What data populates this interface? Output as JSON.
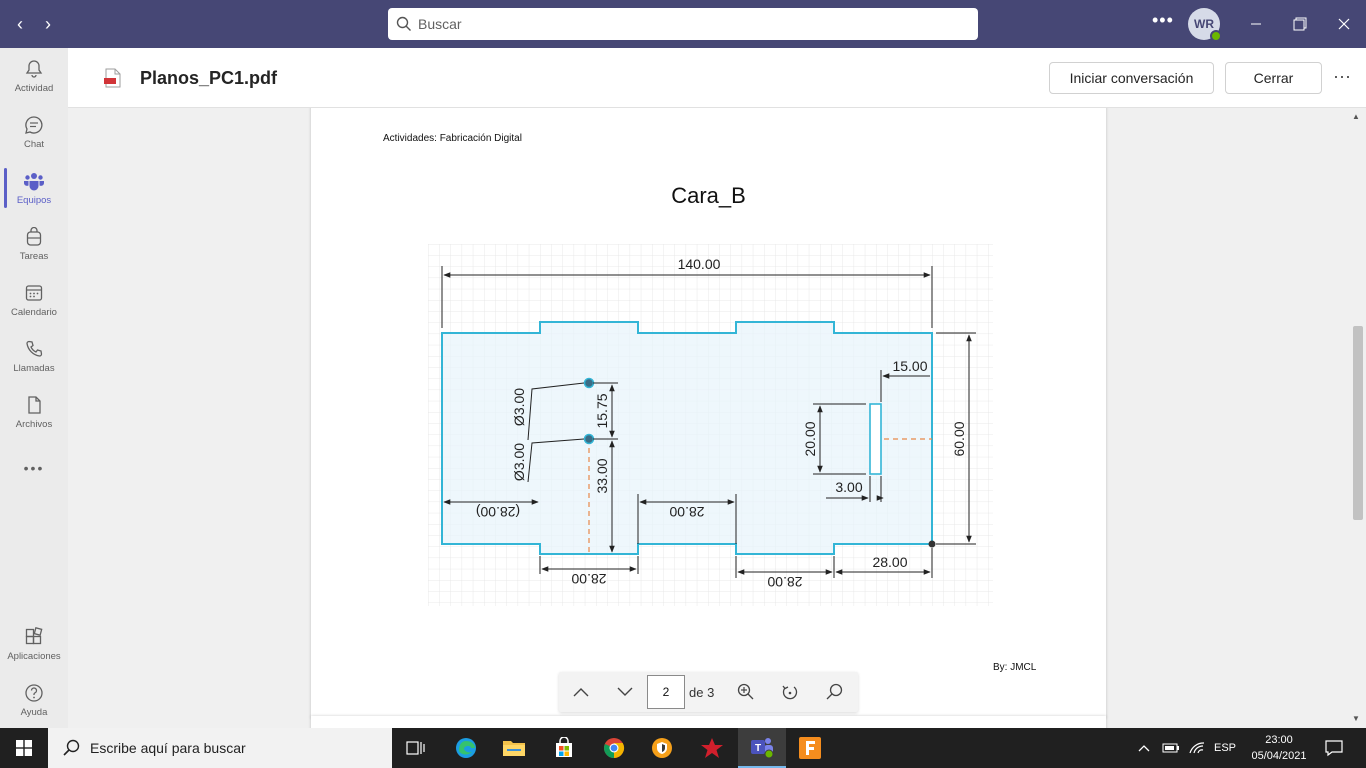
{
  "titlebar": {
    "search_placeholder": "Buscar",
    "avatar_initials": "WR"
  },
  "rail": {
    "items": [
      {
        "label": "Actividad",
        "icon": "bell-icon"
      },
      {
        "label": "Chat",
        "icon": "chat-icon"
      },
      {
        "label": "Equipos",
        "icon": "teams-icon",
        "active": true
      },
      {
        "label": "Tareas",
        "icon": "backpack-icon"
      },
      {
        "label": "Calendario",
        "icon": "calendar-icon"
      },
      {
        "label": "Llamadas",
        "icon": "phone-icon"
      },
      {
        "label": "Archivos",
        "icon": "file-icon"
      }
    ],
    "bottom": [
      {
        "label": "Aplicaciones",
        "icon": "apps-icon"
      },
      {
        "label": "Ayuda",
        "icon": "help-icon"
      }
    ]
  },
  "file": {
    "name": "Planos_PC1.pdf",
    "start_conversation": "Iniciar conversación",
    "close": "Cerrar"
  },
  "document": {
    "header": "Actividades: Fabricación Digital",
    "title": "Cara_B",
    "author": "By: JMCL",
    "dimensions": {
      "total_width": "140.00",
      "height": "60.00",
      "slot_offset": "15.00",
      "slot_height": "20.00",
      "slot_width": "3.00",
      "right_margin": "28.00",
      "hole_diameter_1": "Ø3.00",
      "hole_diameter_2": "Ø3.00",
      "hole_spacing": "15.75",
      "hole_height": "33.00",
      "left_offset": "(28.00)",
      "tab_width_1": "28.00",
      "tab_width_2": "28.00",
      "bottom_tab_1": "28.00",
      "bottom_tab_2": "28.00"
    }
  },
  "pdf_toolbar": {
    "page": "2",
    "of": "de 3"
  },
  "taskbar": {
    "search_placeholder": "Escribe aquí para buscar",
    "language": "ESP",
    "time": "23:00",
    "date": "05/04/2021"
  },
  "colors": {
    "titlebar": "#464775",
    "accent": "#5b5fc7",
    "outline": "#33b5d6"
  }
}
